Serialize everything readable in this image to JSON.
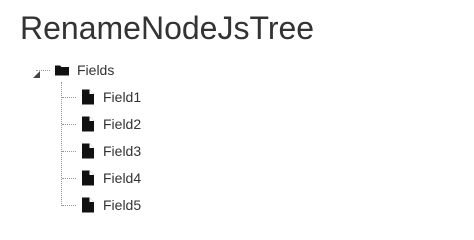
{
  "page": {
    "title": "RenameNodeJsTree"
  },
  "tree": {
    "root": {
      "label": "Fields",
      "icon": "folder-icon",
      "expanded": true
    },
    "children": [
      {
        "label": "Field1",
        "icon": "file-icon"
      },
      {
        "label": "Field2",
        "icon": "file-icon"
      },
      {
        "label": "Field3",
        "icon": "file-icon"
      },
      {
        "label": "Field4",
        "icon": "file-icon"
      },
      {
        "label": "Field5",
        "icon": "file-icon"
      }
    ]
  }
}
